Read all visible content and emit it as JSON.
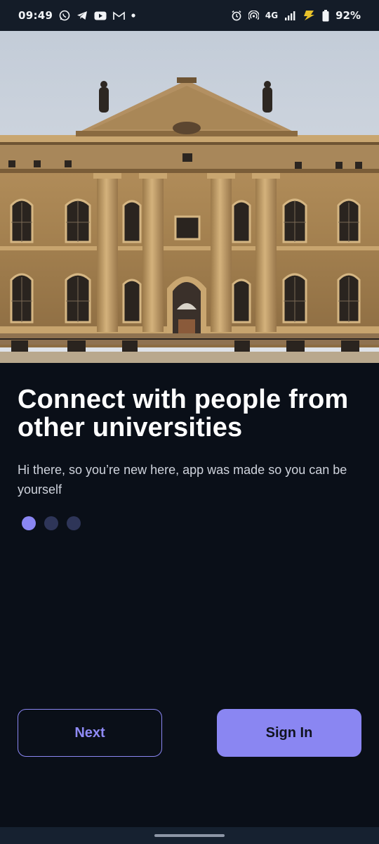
{
  "status_bar": {
    "time": "09:49",
    "network": "4G",
    "battery": "92%",
    "icons_left": [
      "whatsapp-icon",
      "telegram-icon",
      "youtube-icon",
      "gmail-icon",
      "notification-dot-icon"
    ],
    "icons_right": [
      "alarm-icon",
      "hotspot-icon",
      "signal-icon",
      "charging-icon",
      "battery-icon"
    ]
  },
  "hero": {
    "image": "university-building-photo"
  },
  "onboarding": {
    "title": "Connect with people from other universities",
    "subtitle": "Hi there, so you’re new here, app was made so you can be yourself",
    "page_total": 3,
    "page_current": 1
  },
  "actions": {
    "next_label": "Next",
    "signin_label": "Sign In"
  },
  "colors": {
    "background": "#0a0f18",
    "accent": "#8a86f2",
    "dot_inactive": "#2e3558"
  }
}
